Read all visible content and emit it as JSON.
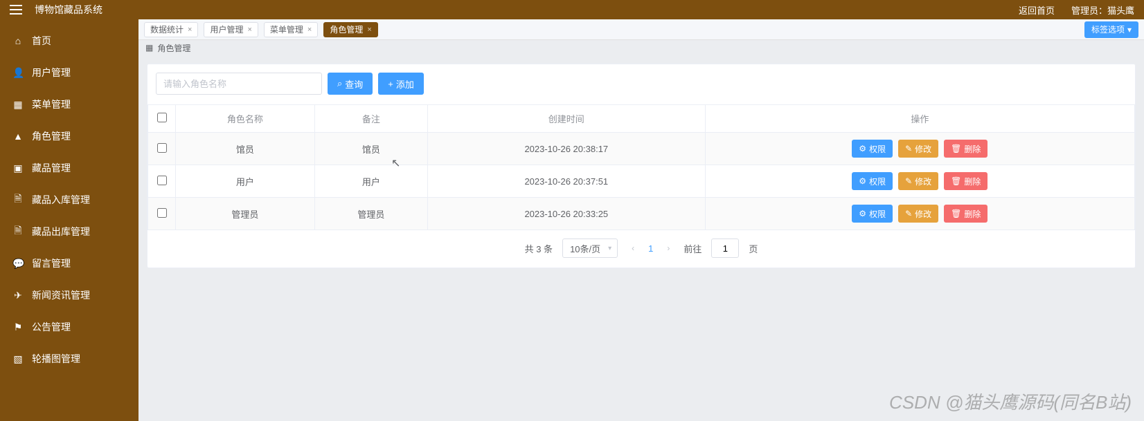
{
  "header": {
    "title": "博物馆藏品系统",
    "home_link": "返回首页",
    "admin_label": "管理员：猫头鹰"
  },
  "sidebar": {
    "items": [
      {
        "icon": "⌂",
        "label": "首页"
      },
      {
        "icon": "👤",
        "label": "用户管理"
      },
      {
        "icon": "▦",
        "label": "菜单管理"
      },
      {
        "icon": "▲",
        "label": "角色管理"
      },
      {
        "icon": "▣",
        "label": "藏品管理"
      },
      {
        "icon": "🗎",
        "label": "藏品入库管理"
      },
      {
        "icon": "🗎",
        "label": "藏品出库管理"
      },
      {
        "icon": "💬",
        "label": "留言管理"
      },
      {
        "icon": "✈",
        "label": "新闻资讯管理"
      },
      {
        "icon": "⚑",
        "label": "公告管理"
      },
      {
        "icon": "▧",
        "label": "轮播图管理"
      }
    ]
  },
  "tabs": {
    "items": [
      {
        "label": "数据统计",
        "active": false
      },
      {
        "label": "用户管理",
        "active": false
      },
      {
        "label": "菜单管理",
        "active": false
      },
      {
        "label": "角色管理",
        "active": true
      }
    ],
    "tag_button": "标签选项"
  },
  "breadcrumb": {
    "title": "角色管理"
  },
  "toolbar": {
    "search_placeholder": "请输入角色名称",
    "search_btn": "查询",
    "add_btn": "添加"
  },
  "table": {
    "columns": [
      "角色名称",
      "备注",
      "创建时间",
      "操作"
    ],
    "rows": [
      {
        "name": "馆员",
        "remark": "馆员",
        "time": "2023-10-26 20:38:17"
      },
      {
        "name": "用户",
        "remark": "用户",
        "time": "2023-10-26 20:37:51"
      },
      {
        "name": "管理员",
        "remark": "管理员",
        "time": "2023-10-26 20:33:25"
      }
    ],
    "actions": {
      "perm": "权限",
      "edit": "修改",
      "del": "删除"
    }
  },
  "pager": {
    "total_text": "共 3 条",
    "page_size": "10条/页",
    "current": "1",
    "goto_prefix": "前往",
    "goto_value": "1",
    "goto_suffix": "页"
  },
  "watermark": "CSDN @猫头鹰源码(同名B站)"
}
